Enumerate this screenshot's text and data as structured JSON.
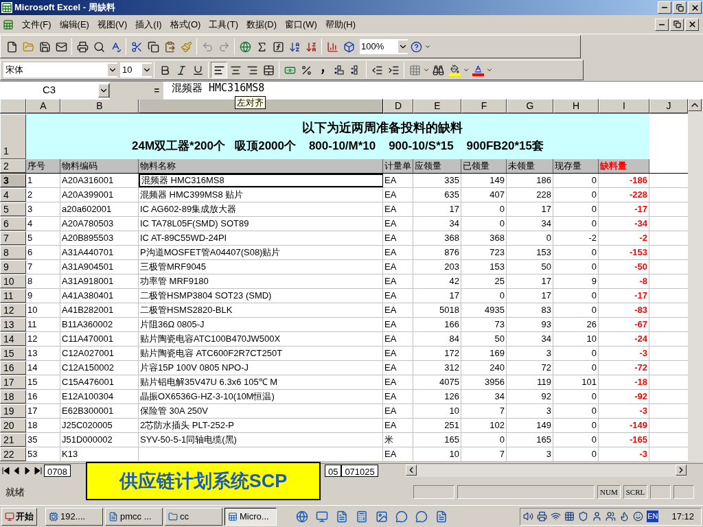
{
  "window": {
    "title": "Microsoft Excel - 周缺料"
  },
  "menu": [
    {
      "label": "文件(F)"
    },
    {
      "label": "编辑(E)"
    },
    {
      "label": "视图(V)"
    },
    {
      "label": "插入(I)"
    },
    {
      "label": "格式(O)"
    },
    {
      "label": "工具(T)"
    },
    {
      "label": "数据(D)"
    },
    {
      "label": "窗口(W)"
    },
    {
      "label": "帮助(H)"
    }
  ],
  "toolbar": {
    "zoom": "100%"
  },
  "format_bar": {
    "font": "宋体",
    "size": "10"
  },
  "formula_bar": {
    "cell": "C3",
    "equals": "=",
    "value": "混频器 HMC316MS8"
  },
  "tooltip": "左对齐",
  "columns": [
    {
      "label": "A",
      "selected": false
    },
    {
      "label": "B",
      "selected": false
    },
    {
      "selected": true
    },
    {
      "label": "D",
      "selected": false
    },
    {
      "label": "E",
      "selected": false
    },
    {
      "label": "F",
      "selected": false
    },
    {
      "label": "G",
      "selected": false
    },
    {
      "label": "H",
      "selected": false
    },
    {
      "label": "I",
      "selected": false
    },
    {
      "label": "J",
      "selected": false
    }
  ],
  "sheet": {
    "title_row": "1",
    "title": "以下为近两周准备投料的缺料",
    "subtitle": "24M双工器*200个   吸顶2000个    800-10/M*10    900-10/S*15    900FB20*15套",
    "header_row": "2",
    "headers": [
      "序号",
      "物料编码",
      "物料名称",
      "计量单",
      "应领量",
      "已领量",
      "未领量",
      "现存量",
      "缺料量"
    ],
    "rows": [
      {
        "num": "3",
        "selected": true,
        "cells": [
          "1",
          "A20A316001",
          "混频器 HMC316MS8",
          "EA",
          "335",
          "149",
          "186",
          "0",
          "-186"
        ]
      },
      {
        "num": "4",
        "selected": false,
        "cells": [
          "2",
          "A20A399001",
          "混频器 HMC399MS8 贴片",
          "EA",
          "635",
          "407",
          "228",
          "0",
          "-228"
        ]
      },
      {
        "num": "5",
        "selected": false,
        "cells": [
          "3",
          "a20a602001",
          "IC AG602-89集成放大器",
          "EA",
          "17",
          "0",
          "17",
          "0",
          "-17"
        ]
      },
      {
        "num": "6",
        "selected": false,
        "cells": [
          "4",
          "A20A780503",
          "IC  TA78L05F(SMD) SOT89",
          "EA",
          "34",
          "0",
          "34",
          "0",
          "-34"
        ]
      },
      {
        "num": "7",
        "selected": false,
        "cells": [
          "5",
          "A20B895503",
          "IC AT-89C55WD-24PI",
          "EA",
          "368",
          "368",
          "0",
          "-2",
          "-2"
        ]
      },
      {
        "num": "8",
        "selected": false,
        "cells": [
          "6",
          "A31A440701",
          "P沟道MOSFET管A04407(S08)贴片",
          "EA",
          "876",
          "723",
          "153",
          "0",
          "-153"
        ]
      },
      {
        "num": "9",
        "selected": false,
        "cells": [
          "7",
          "A31A904501",
          "三极管MRF9045",
          "EA",
          "203",
          "153",
          "50",
          "0",
          "-50"
        ]
      },
      {
        "num": "10",
        "selected": false,
        "cells": [
          "8",
          "A31A918001",
          "功率管 MRF9180",
          "EA",
          "42",
          "25",
          "17",
          "9",
          "-8"
        ]
      },
      {
        "num": "11",
        "selected": false,
        "cells": [
          "9",
          "A41A380401",
          "二极管HSMP3804 SOT23 (SMD)",
          "EA",
          "17",
          "0",
          "17",
          "0",
          "-17"
        ]
      },
      {
        "num": "12",
        "selected": false,
        "cells": [
          "10",
          "A41B282001",
          "二极管HSMS2820-BLK",
          "EA",
          "5018",
          "4935",
          "83",
          "0",
          "-83"
        ]
      },
      {
        "num": "13",
        "selected": false,
        "cells": [
          "11",
          "B11A360002",
          "片阻36Ω 0805-J",
          "EA",
          "166",
          "73",
          "93",
          "26",
          "-67"
        ]
      },
      {
        "num": "14",
        "selected": false,
        "cells": [
          "12",
          "C11A470001",
          "贴片陶瓷电容ATC100B470JW500X",
          "EA",
          "84",
          "50",
          "34",
          "10",
          "-24"
        ]
      },
      {
        "num": "15",
        "selected": false,
        "cells": [
          "13",
          "C12A027001",
          "贴片陶瓷电容 ATC600F2R7CT250T",
          "EA",
          "172",
          "169",
          "3",
          "0",
          "-3"
        ]
      },
      {
        "num": "16",
        "selected": false,
        "cells": [
          "14",
          "C12A150002",
          "片容15P 100V 0805 NPO-J",
          "EA",
          "312",
          "240",
          "72",
          "0",
          "-72"
        ]
      },
      {
        "num": "17",
        "selected": false,
        "cells": [
          "15",
          "C15A476001",
          "贴片铝电解35V47U 6.3x6 105℃ M",
          "EA",
          "4075",
          "3956",
          "119",
          "101",
          "-18"
        ]
      },
      {
        "num": "18",
        "selected": false,
        "cells": [
          "16",
          "E12A100304",
          "晶振OX6536G-HZ-3-10(10M恒温)",
          "EA",
          "126",
          "34",
          "92",
          "0",
          "-92"
        ]
      },
      {
        "num": "19",
        "selected": false,
        "cells": [
          "17",
          "E62B300001",
          "保险管  30A  250V",
          "EA",
          "10",
          "7",
          "3",
          "0",
          "-3"
        ]
      },
      {
        "num": "20",
        "selected": false,
        "cells": [
          "18",
          "J25C020005",
          "2芯防水插头 PLT-252-P",
          "EA",
          "251",
          "102",
          "149",
          "0",
          "-149"
        ]
      },
      {
        "num": "21",
        "selected": false,
        "cells": [
          "35",
          "J51D000002",
          "SYV-50-5-1同轴电缆(黑)",
          "米",
          "165",
          "0",
          "165",
          "0",
          "-165"
        ]
      },
      {
        "num": "22",
        "selected": false,
        "cells": [
          "53",
          "K13",
          null,
          "EA",
          "10",
          "7",
          "3",
          "0",
          "-3"
        ]
      }
    ]
  },
  "sheet_tabs": [
    {
      "label": "0708"
    },
    {
      "label": "05"
    },
    {
      "label": "071025"
    }
  ],
  "status_bar": {
    "text": "就绪",
    "indicators": [
      "NUM",
      "SCRL"
    ]
  },
  "overlay": "供应链计划系统SCP",
  "taskbar": {
    "start": "开始",
    "tasks": [
      {
        "label": "192....",
        "selected": false
      },
      {
        "label": "pmcc ...",
        "selected": false
      },
      {
        "label": "cc",
        "selected": false
      },
      {
        "label": "Micro...",
        "selected": true
      }
    ],
    "lang": "EN",
    "clock": "17:12"
  }
}
